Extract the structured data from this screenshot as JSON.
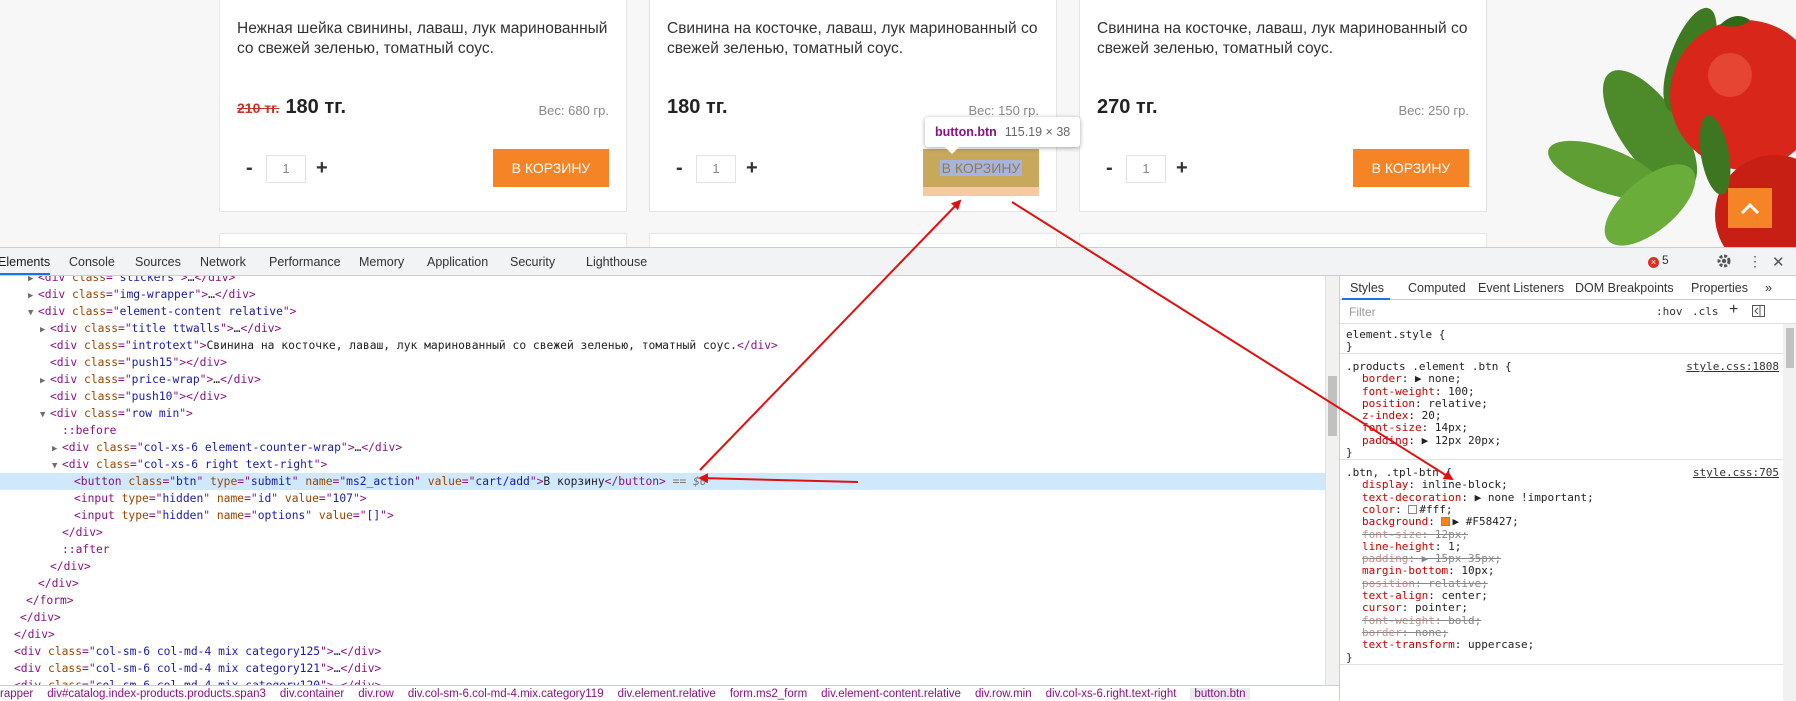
{
  "page": {
    "cards": [
      {
        "intro": "Нежная шейка свинины, лаваш, лук маринованный со свежей зеленью, томатный соус.",
        "old_price": "210 тг.",
        "price": "180 тг.",
        "weight": "Вес: 680 гр.",
        "qty": "1",
        "minus": "-",
        "plus": "+",
        "button": "В КОРЗИНУ"
      },
      {
        "intro": "Свинина на косточке, лаваш, лук маринованный со свежей зеленью, томатный соус.",
        "old_price": "",
        "price": "180 тг.",
        "weight": "Вес: 150 гр.",
        "qty": "1",
        "minus": "-",
        "plus": "+",
        "button": "В КОРЗИНУ"
      },
      {
        "intro": "Свинина на косточке, лаваш, лук маринованный со свежей зеленью, томатный соус.",
        "old_price": "",
        "price": "270 тг.",
        "weight": "Вес: 250 гр.",
        "qty": "1",
        "minus": "-",
        "plus": "+",
        "button": "В КОРЗИНУ"
      }
    ],
    "tooltip": {
      "tag": "button.btn",
      "dims": "115.19 × 38"
    },
    "accent": "#F58427"
  },
  "devtools": {
    "tabs": [
      "Elements",
      "Console",
      "Sources",
      "Network",
      "Performance",
      "Memory",
      "Application",
      "Security",
      "Lighthouse"
    ],
    "error_count": "5",
    "dom_lines": [
      {
        "t": "▶",
        "indent": 2,
        "h": [
          [
            "tg",
            "<div "
          ],
          [
            "at",
            "class"
          ],
          [
            "tg",
            "=\""
          ],
          [
            "av",
            "stickers"
          ],
          [
            "tg",
            "\">"
          ],
          [
            "tx",
            "…"
          ],
          [
            "tg",
            "</div>"
          ]
        ]
      },
      {
        "t": "▶",
        "indent": 2,
        "h": [
          [
            "tg",
            "<div "
          ],
          [
            "at",
            "class"
          ],
          [
            "tg",
            "=\""
          ],
          [
            "av",
            "img-wrapper"
          ],
          [
            "tg",
            "\">"
          ],
          [
            "tx",
            "…"
          ],
          [
            "tg",
            "</div>"
          ]
        ]
      },
      {
        "t": "▼",
        "indent": 2,
        "h": [
          [
            "tg",
            "<div "
          ],
          [
            "at",
            "class"
          ],
          [
            "tg",
            "=\""
          ],
          [
            "av",
            "element-content relative"
          ],
          [
            "tg",
            "\">"
          ]
        ]
      },
      {
        "t": "▶",
        "indent": 3,
        "h": [
          [
            "tg",
            "<div "
          ],
          [
            "at",
            "class"
          ],
          [
            "tg",
            "=\""
          ],
          [
            "av",
            "title ttwalls"
          ],
          [
            "tg",
            "\">"
          ],
          [
            "tx",
            "…"
          ],
          [
            "tg",
            "</div>"
          ]
        ]
      },
      {
        "t": "",
        "indent": 3,
        "h": [
          [
            "tg",
            "<div "
          ],
          [
            "at",
            "class"
          ],
          [
            "tg",
            "=\""
          ],
          [
            "av",
            "introtext"
          ],
          [
            "tg",
            "\">"
          ],
          [
            "tx",
            "Свинина на косточке, лаваш, лук маринованный со свежей зеленью, томатный соус."
          ],
          [
            "tg",
            "</div>"
          ]
        ]
      },
      {
        "t": "",
        "indent": 3,
        "h": [
          [
            "tg",
            "<div "
          ],
          [
            "at",
            "class"
          ],
          [
            "tg",
            "=\""
          ],
          [
            "av",
            "push15"
          ],
          [
            "tg",
            "\">"
          ],
          [
            "tg",
            "</div>"
          ]
        ]
      },
      {
        "t": "▶",
        "indent": 3,
        "h": [
          [
            "tg",
            "<div "
          ],
          [
            "at",
            "class"
          ],
          [
            "tg",
            "=\""
          ],
          [
            "av",
            "price-wrap"
          ],
          [
            "tg",
            "\">"
          ],
          [
            "tx",
            "…"
          ],
          [
            "tg",
            "</div>"
          ]
        ]
      },
      {
        "t": "",
        "indent": 3,
        "h": [
          [
            "tg",
            "<div "
          ],
          [
            "at",
            "class"
          ],
          [
            "tg",
            "=\""
          ],
          [
            "av",
            "push10"
          ],
          [
            "tg",
            "\">"
          ],
          [
            "tg",
            "</div>"
          ]
        ]
      },
      {
        "t": "▼",
        "indent": 3,
        "h": [
          [
            "tg",
            "<div "
          ],
          [
            "at",
            "class"
          ],
          [
            "tg",
            "=\""
          ],
          [
            "av",
            "row min"
          ],
          [
            "tg",
            "\">"
          ]
        ]
      },
      {
        "t": "",
        "indent": 4,
        "h": [
          [
            "ps",
            "::before"
          ]
        ]
      },
      {
        "t": "▶",
        "indent": 4,
        "h": [
          [
            "tg",
            "<div "
          ],
          [
            "at",
            "class"
          ],
          [
            "tg",
            "=\""
          ],
          [
            "av",
            "col-xs-6 element-counter-wrap"
          ],
          [
            "tg",
            "\">"
          ],
          [
            "tx",
            "…"
          ],
          [
            "tg",
            "</div>"
          ]
        ]
      },
      {
        "t": "▼",
        "indent": 4,
        "h": [
          [
            "tg",
            "<div "
          ],
          [
            "at",
            "class"
          ],
          [
            "tg",
            "=\""
          ],
          [
            "av",
            "col-xs-6 right text-right"
          ],
          [
            "tg",
            "\">"
          ]
        ]
      },
      {
        "t": "",
        "indent": 5,
        "sel": true,
        "h": [
          [
            "tg",
            "<button "
          ],
          [
            "at",
            "class"
          ],
          [
            "tg",
            "=\""
          ],
          [
            "av",
            "btn"
          ],
          [
            "tg",
            "\" "
          ],
          [
            "at",
            "type"
          ],
          [
            "tg",
            "=\""
          ],
          [
            "av",
            "submit"
          ],
          [
            "tg",
            "\" "
          ],
          [
            "at",
            "name"
          ],
          [
            "tg",
            "=\""
          ],
          [
            "av",
            "ms2_action"
          ],
          [
            "tg",
            "\" "
          ],
          [
            "at",
            "value"
          ],
          [
            "tg",
            "=\""
          ],
          [
            "av",
            "cart/add"
          ],
          [
            "tg",
            "\">"
          ],
          [
            "tx",
            "В корзину"
          ],
          [
            "tg",
            "</button>"
          ],
          [
            "cm",
            " == $0"
          ]
        ]
      },
      {
        "t": "",
        "indent": 5,
        "h": [
          [
            "tg",
            "<input "
          ],
          [
            "at",
            "type"
          ],
          [
            "tg",
            "=\""
          ],
          [
            "av",
            "hidden"
          ],
          [
            "tg",
            "\" "
          ],
          [
            "at",
            "name"
          ],
          [
            "tg",
            "=\""
          ],
          [
            "av",
            "id"
          ],
          [
            "tg",
            "\" "
          ],
          [
            "at",
            "value"
          ],
          [
            "tg",
            "=\""
          ],
          [
            "av",
            "107"
          ],
          [
            "tg",
            "\">"
          ]
        ]
      },
      {
        "t": "",
        "indent": 5,
        "h": [
          [
            "tg",
            "<input "
          ],
          [
            "at",
            "type"
          ],
          [
            "tg",
            "=\""
          ],
          [
            "av",
            "hidden"
          ],
          [
            "tg",
            "\" "
          ],
          [
            "at",
            "name"
          ],
          [
            "tg",
            "=\""
          ],
          [
            "av",
            "options"
          ],
          [
            "tg",
            "\" "
          ],
          [
            "at",
            "value"
          ],
          [
            "tg",
            "=\""
          ],
          [
            "av",
            "[]"
          ],
          [
            "tg",
            "\">"
          ]
        ]
      },
      {
        "t": "",
        "indent": 4,
        "h": [
          [
            "tg",
            "</div>"
          ]
        ]
      },
      {
        "t": "",
        "indent": 4,
        "h": [
          [
            "ps",
            "::after"
          ]
        ]
      },
      {
        "t": "",
        "indent": 3,
        "h": [
          [
            "tg",
            "</div>"
          ]
        ]
      },
      {
        "t": "",
        "indent": 2,
        "h": [
          [
            "tg",
            "</div>"
          ]
        ]
      },
      {
        "t": "",
        "indent": 1,
        "h": [
          [
            "tg",
            "</form>"
          ]
        ]
      },
      {
        "t": "",
        "indent": 0.5,
        "h": [
          [
            "tg",
            "</div>"
          ]
        ]
      },
      {
        "t": "",
        "indent": 0,
        "h": [
          [
            "tg",
            "</div>"
          ]
        ]
      },
      {
        "t": "",
        "indent": 0,
        "h": [
          [
            "tg",
            "<div "
          ],
          [
            "at",
            "class"
          ],
          [
            "tg",
            "=\""
          ],
          [
            "av",
            "col-sm-6 col-md-4 mix category125"
          ],
          [
            "tg",
            "\">"
          ],
          [
            "tx",
            "…"
          ],
          [
            "tg",
            "</div>"
          ]
        ]
      },
      {
        "t": "",
        "indent": 0,
        "h": [
          [
            "tg",
            "<div "
          ],
          [
            "at",
            "class"
          ],
          [
            "tg",
            "=\""
          ],
          [
            "av",
            "col-sm-6 col-md-4 mix category121"
          ],
          [
            "tg",
            "\">"
          ],
          [
            "tx",
            "…"
          ],
          [
            "tg",
            "</div>"
          ]
        ]
      },
      {
        "t": "",
        "indent": 0,
        "h": [
          [
            "tg",
            "<div "
          ],
          [
            "at",
            "class"
          ],
          [
            "tg",
            "=\""
          ],
          [
            "av",
            "col-sm-6 col-md-4 mix category120"
          ],
          [
            "tg",
            "\">"
          ],
          [
            "tx",
            "…"
          ],
          [
            "tg",
            "</div>"
          ]
        ]
      }
    ],
    "breadcrumbs": [
      "rapper",
      "div#catalog.index-products.products.span3",
      "div.container",
      "div.row",
      "div.col-sm-6.col-md-4.mix.category119",
      "div.element.relative",
      "form.ms2_form",
      "div.element-content.relative",
      "div.row.min",
      "div.col-xs-6.right.text-right",
      "button.btn"
    ],
    "styles": {
      "tabs": [
        "Styles",
        "Computed",
        "Event Listeners",
        "DOM Breakpoints",
        "Properties",
        "»"
      ],
      "filter_placeholder": "Filter",
      "hov": ":hov",
      "cls": ".cls",
      "plus": "+",
      "rules": [
        {
          "selector": "element.style {",
          "source": "",
          "decls": []
        },
        {
          "selector": ".products .element .btn {",
          "source": "style.css:1808",
          "decls": [
            {
              "p": "border",
              "v": "▶ none;",
              "s": false
            },
            {
              "p": "font-weight",
              "v": "100;",
              "s": false
            },
            {
              "p": "position",
              "v": "relative;",
              "s": false
            },
            {
              "p": "z-index",
              "v": "20;",
              "s": false
            },
            {
              "p": "font-size",
              "v": "14px;",
              "s": false
            },
            {
              "p": "padding",
              "v": "▶ 12px 20px;",
              "s": false
            }
          ]
        },
        {
          "selector": ".btn, .tpl-btn {",
          "source": "style.css:705",
          "decls": [
            {
              "p": "display",
              "v": "inline-block;",
              "s": false
            },
            {
              "p": "text-decoration",
              "v": "▶ none !important;",
              "s": false
            },
            {
              "p": "color",
              "v": "#fff;",
              "s": false,
              "sw": "#ffffff"
            },
            {
              "p": "background",
              "v": "▶ #F58427;",
              "s": false,
              "sw": "#F58427"
            },
            {
              "p": "font-size",
              "v": "12px;",
              "s": true
            },
            {
              "p": "line-height",
              "v": "1;",
              "s": false
            },
            {
              "p": "padding",
              "v": "▶ 15px 35px;",
              "s": true
            },
            {
              "p": "margin-bottom",
              "v": "10px;",
              "s": false
            },
            {
              "p": "position",
              "v": "relative;",
              "s": true
            },
            {
              "p": "text-align",
              "v": "center;",
              "s": false
            },
            {
              "p": "cursor",
              "v": "pointer;",
              "s": false
            },
            {
              "p": "font-weight",
              "v": "bold;",
              "s": true
            },
            {
              "p": "border",
              "v": "none;",
              "s": true
            },
            {
              "p": "text-transform",
              "v": "uppercase;",
              "s": false
            }
          ]
        }
      ]
    }
  }
}
